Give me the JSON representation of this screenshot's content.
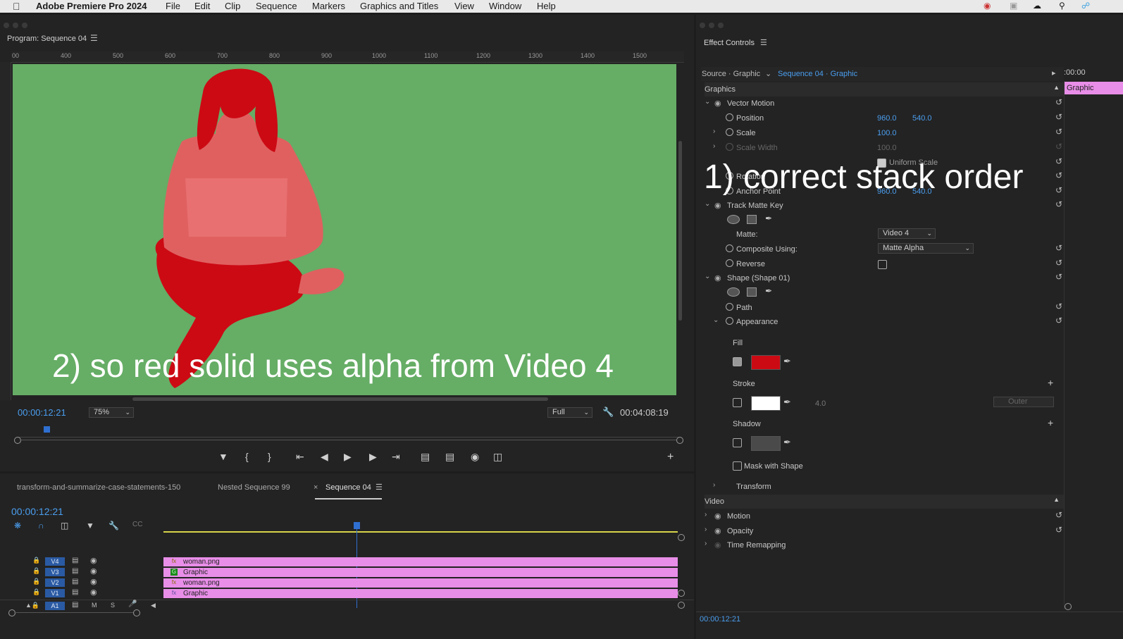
{
  "menubar": {
    "app": "Adobe Premiere Pro 2024",
    "items": [
      "File",
      "Edit",
      "Clip",
      "Sequence",
      "Markers",
      "Graphics and Titles",
      "View",
      "Window",
      "Help"
    ]
  },
  "program": {
    "title": "Program: Sequence 04",
    "ruler": [
      "00",
      "400",
      "500",
      "600",
      "700",
      "800",
      "900",
      "1000",
      "1100",
      "1200",
      "1300",
      "1400",
      "1500"
    ],
    "timecode": "00:00:12:21",
    "zoom": "75%",
    "resolution": "Full",
    "duration": "00:04:08:19",
    "annotation2": "2) so red solid uses alpha from Video 4"
  },
  "effect_controls": {
    "title": "Effect Controls",
    "source": "Source · Graphic",
    "sequence": "Sequence 04 · Graphic",
    "time": ":00:00",
    "clip_label": "Graphic",
    "graphics_header": "Graphics",
    "vector_motion": "Vector Motion",
    "position_label": "Position",
    "position_x": "960.0",
    "position_y": "540.0",
    "scale_label": "Scale",
    "scale_val": "100.0",
    "scale_width_label": "Scale Width",
    "scale_width_val": "100.0",
    "uniform_scale": "Uniform Scale",
    "rotation_label": "Rotation",
    "anchor_label": "Anchor Point",
    "anchor_x": "960.0",
    "anchor_y": "540.0",
    "track_matte": "Track Matte Key",
    "matte_label": "Matte:",
    "matte_val": "Video 4",
    "composite_label": "Composite Using:",
    "composite_val": "Matte Alpha",
    "reverse_label": "Reverse",
    "shape_label": "Shape (Shape 01)",
    "path_label": "Path",
    "appearance_label": "Appearance",
    "fill_label": "Fill",
    "stroke_label": "Stroke",
    "stroke_width": "4.0",
    "stroke_pos": "Outer",
    "shadow_label": "Shadow",
    "mask_label": "Mask with Shape",
    "transform_label": "Transform",
    "video_header": "Video",
    "motion_label": "Motion",
    "opacity_label": "Opacity",
    "time_remap_label": "Time Remapping",
    "footer_tc": "00:00:12:21",
    "annotation1": "1) correct stack order",
    "fill_color": "#cc0a14",
    "stroke_color": "#ffffff",
    "shadow_color": "#4a4a4a"
  },
  "timeline": {
    "tabs": [
      "transform-and-summarize-case-statements-150",
      "Nested Sequence 99",
      "Sequence 04"
    ],
    "timecode": "00:00:12:21",
    "tracks": [
      {
        "id": "V4",
        "clip": "woman.png",
        "icon": "fx"
      },
      {
        "id": "V3",
        "clip": "Graphic",
        "icon": "G"
      },
      {
        "id": "V2",
        "clip": "woman.png",
        "icon": "fx"
      },
      {
        "id": "V1",
        "clip": "Graphic",
        "icon": "fx"
      }
    ],
    "audio_track": "A1",
    "audio_m": "M",
    "audio_s": "S"
  },
  "colors": {
    "green_bg": "#66ad66",
    "clip_pink": "#e88ee8",
    "accent_blue": "#4a9eef"
  }
}
